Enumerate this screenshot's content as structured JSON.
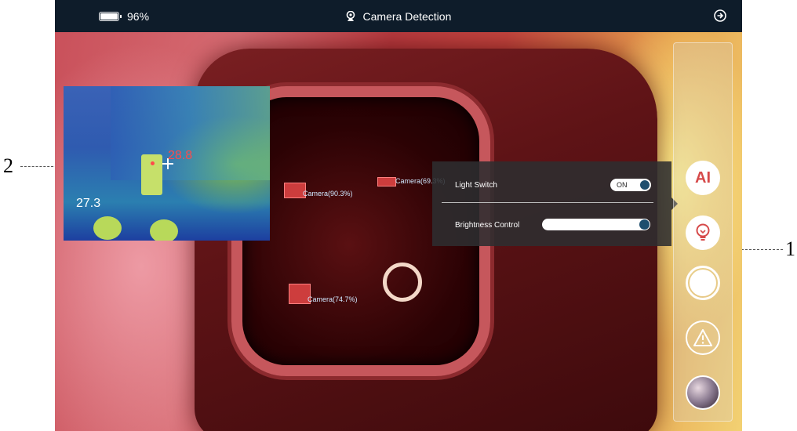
{
  "status_bar": {
    "battery_percent": "96%",
    "title": "Camera Detection",
    "icons": {
      "battery": "battery-icon",
      "title": "webcam-icon",
      "exit": "exit-arrow-icon"
    }
  },
  "thermal": {
    "hot_value": "28.8",
    "cold_value": "27.3"
  },
  "detections": [
    {
      "label": "Camera(90.3%)"
    },
    {
      "label": "Camera(69.3%)"
    },
    {
      "label": "Camera(74.7%)"
    }
  ],
  "popup": {
    "light_switch_label": "Light Switch",
    "toggle_state": "ON",
    "brightness_label": "Brightness Control",
    "brightness_level": 1.0
  },
  "sidebar": {
    "ai_label": "AI",
    "icons": [
      "ai-icon",
      "lightbulb-icon",
      "shutter-icon",
      "warning-icon",
      "gallery-icon"
    ]
  },
  "callouts": {
    "left": "2",
    "right": "1"
  },
  "colors": {
    "topbar": "#0e1c2a",
    "accent_red": "#d64a4a",
    "knob": "#1e4e6e"
  }
}
